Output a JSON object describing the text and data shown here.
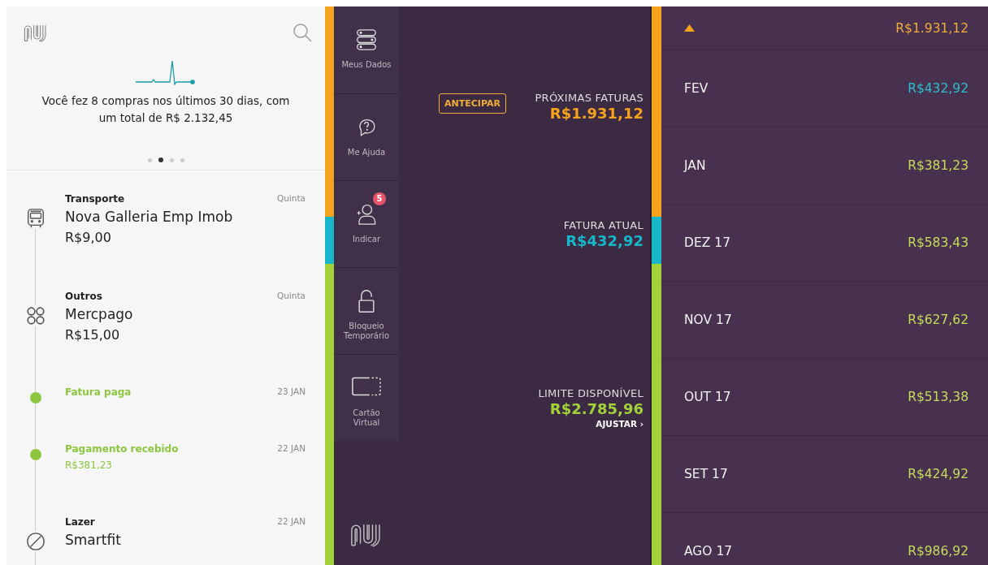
{
  "header": {
    "summary": "Você fez 8 compras nos últimos 30 dias, com um total de R$ 2.132,45",
    "pager": [
      {
        "selected": false
      },
      {
        "selected": true
      },
      {
        "selected": false
      },
      {
        "selected": false
      }
    ]
  },
  "feed": [
    {
      "kind": "transport",
      "category": "Transporte",
      "merchant": "Nova Galleria Emp Imob",
      "amount": "R$9,00",
      "date": "Quinta"
    },
    {
      "kind": "other",
      "category": "Outros",
      "merchant": "Mercpago",
      "amount": "R$15,00",
      "date": "Quinta"
    },
    {
      "kind": "payment",
      "category": "Fatura paga",
      "date": "23 JAN"
    },
    {
      "kind": "payment",
      "category": "Pagamento recebido",
      "amount": "R$381,23",
      "date": "22 JAN"
    },
    {
      "kind": "leisure",
      "category": "Lazer",
      "merchant": "Smartfit",
      "date": "22 JAN"
    }
  ],
  "sidebar": [
    {
      "label": "Meus Dados"
    },
    {
      "label": "Me Ajuda"
    },
    {
      "label": "Indicar",
      "badge": "5"
    },
    {
      "label": "Bloqueio Temporário"
    },
    {
      "label": "Cartão Virtual"
    }
  ],
  "summary": {
    "button": "ANTECIPAR",
    "link": "AJUSTAR ›",
    "sections": [
      {
        "label": "PRÓXIMAS FATURAS",
        "amount": "R$1.931,12",
        "color": "#f5a31c"
      },
      {
        "label": "FATURA ATUAL",
        "amount": "R$432,92",
        "color": "#17b6c8"
      },
      {
        "label": "LIMITE DISPONÍVEL",
        "amount": "R$2.785,96",
        "color": "#a3d13a"
      }
    ]
  },
  "bills": [
    {
      "kind": "future",
      "amount": "R$1.931,12",
      "color": "#f0ad3a"
    },
    {
      "kind": "month",
      "month": "FEV",
      "amount": "R$432,92",
      "color": "#2cbfcf"
    },
    {
      "kind": "month",
      "month": "JAN",
      "amount": "R$381,23",
      "color": "#c5dc5a"
    },
    {
      "kind": "month",
      "month": "DEZ 17",
      "amount": "R$583,43",
      "color": "#c5dc5a"
    },
    {
      "kind": "month",
      "month": "NOV 17",
      "amount": "R$627,62",
      "color": "#c5dc5a"
    },
    {
      "kind": "month",
      "month": "OUT 17",
      "amount": "R$513,38",
      "color": "#c5dc5a"
    },
    {
      "kind": "month",
      "month": "SET 17",
      "amount": "R$424,92",
      "color": "#c5dc5a"
    },
    {
      "kind": "month",
      "month": "AGO 17",
      "amount": "R$986,92",
      "color": "#c5dc5a"
    }
  ]
}
